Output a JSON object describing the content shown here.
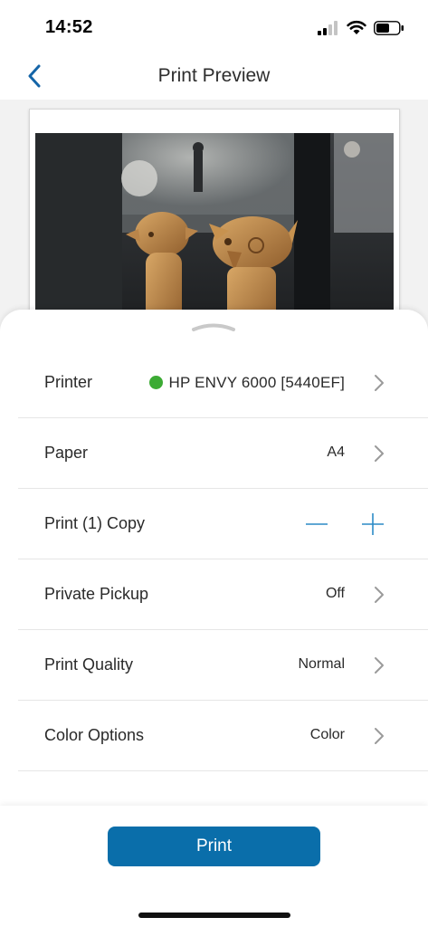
{
  "status_bar": {
    "time": "14:52",
    "icons": [
      "signal-icon",
      "wifi-icon",
      "battery-icon"
    ]
  },
  "nav": {
    "title": "Print Preview",
    "back_icon": "chevron-left-icon"
  },
  "preview": {
    "image_description_icon": "photo-preview"
  },
  "settings": {
    "printer": {
      "label": "Printer",
      "value": "HP ENVY 6000 [5440EF]",
      "status_color": "#3cab34"
    },
    "paper": {
      "label": "Paper",
      "value": "A4"
    },
    "copies": {
      "label": "Print (1) Copy"
    },
    "private_pickup": {
      "label": "Private Pickup",
      "value": "Off"
    },
    "print_quality": {
      "label": "Print Quality",
      "value": "Normal"
    },
    "color_options": {
      "label": "Color Options",
      "value": "Color"
    }
  },
  "footer": {
    "print_label": "Print"
  },
  "colors": {
    "accent": "#0a6eaa",
    "stepper": "#2b8ac6",
    "status_online": "#3cab34"
  }
}
